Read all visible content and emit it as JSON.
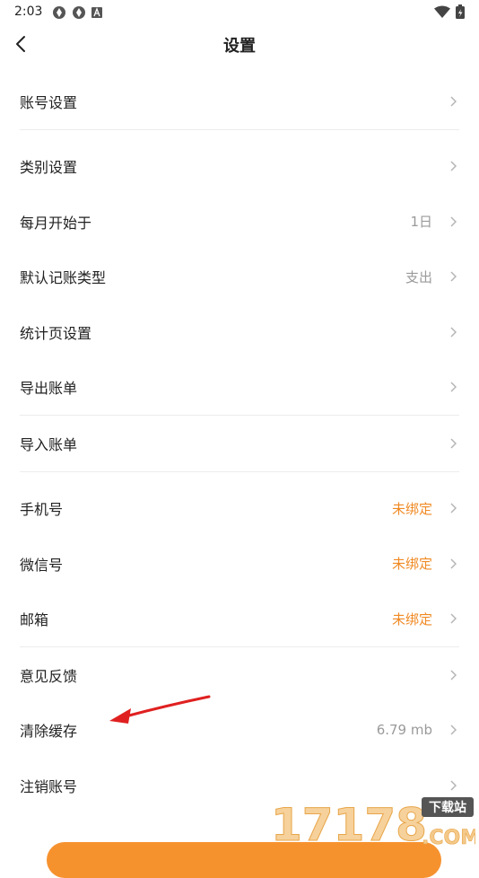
{
  "status_bar": {
    "time": "2:03"
  },
  "header": {
    "title": "设置"
  },
  "groups": [
    {
      "items": [
        {
          "label": "账号设置",
          "value": ""
        }
      ]
    },
    {
      "items": [
        {
          "label": "类别设置",
          "value": ""
        },
        {
          "label": "每月开始于",
          "value": "1日"
        },
        {
          "label": "默认记账类型",
          "value": "支出"
        },
        {
          "label": "统计页设置",
          "value": ""
        },
        {
          "label": "导出账单",
          "value": ""
        }
      ]
    },
    {
      "items": [
        {
          "label": "导入账单",
          "value": ""
        }
      ]
    },
    {
      "items": [
        {
          "label": "手机号",
          "value": "未绑定",
          "value_color": "#f08a24"
        },
        {
          "label": "微信号",
          "value": "未绑定",
          "value_color": "#f08a24"
        },
        {
          "label": "邮箱",
          "value": "未绑定",
          "value_color": "#f08a24"
        }
      ]
    },
    {
      "items": [
        {
          "label": "意见反馈",
          "value": ""
        },
        {
          "label": "清除缓存",
          "value": "6.79 mb"
        },
        {
          "label": "注销账号",
          "value": ""
        }
      ]
    }
  ],
  "watermark": {
    "text": "17178",
    "badge": "下载站",
    "domain": ".COM"
  },
  "colors": {
    "accent": "#f08a24",
    "annotation": "#e02020"
  }
}
